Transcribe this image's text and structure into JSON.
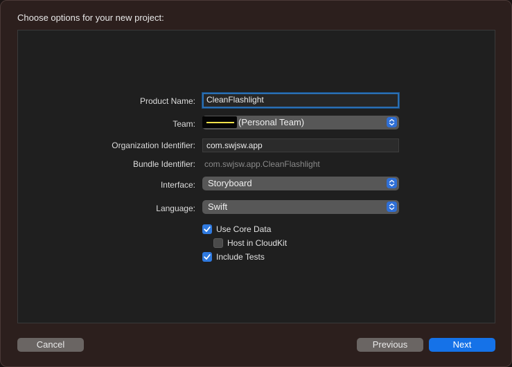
{
  "dialog": {
    "title": "Choose options for your new project:"
  },
  "form": {
    "product_name": {
      "label": "Product Name:",
      "value": "CleanFlashlight"
    },
    "team": {
      "label": "Team:",
      "value": "(Personal Team)"
    },
    "organization_identifier": {
      "label": "Organization Identifier:",
      "value": "com.swjsw.app"
    },
    "bundle_identifier": {
      "label": "Bundle Identifier:",
      "value": "com.swjsw.app.CleanFlashlight"
    },
    "interface": {
      "label": "Interface:",
      "value": "Storyboard"
    },
    "language": {
      "label": "Language:",
      "value": "Swift"
    },
    "use_core_data": {
      "label": "Use Core Data",
      "checked": true
    },
    "host_in_cloudkit": {
      "label": "Host in CloudKit",
      "checked": false
    },
    "include_tests": {
      "label": "Include Tests",
      "checked": true
    }
  },
  "buttons": {
    "cancel": "Cancel",
    "previous": "Previous",
    "next": "Next"
  },
  "colors": {
    "accent": "#1572e8",
    "sheet_background": "#2c1f1d",
    "panel_background": "#1f1f1f"
  }
}
